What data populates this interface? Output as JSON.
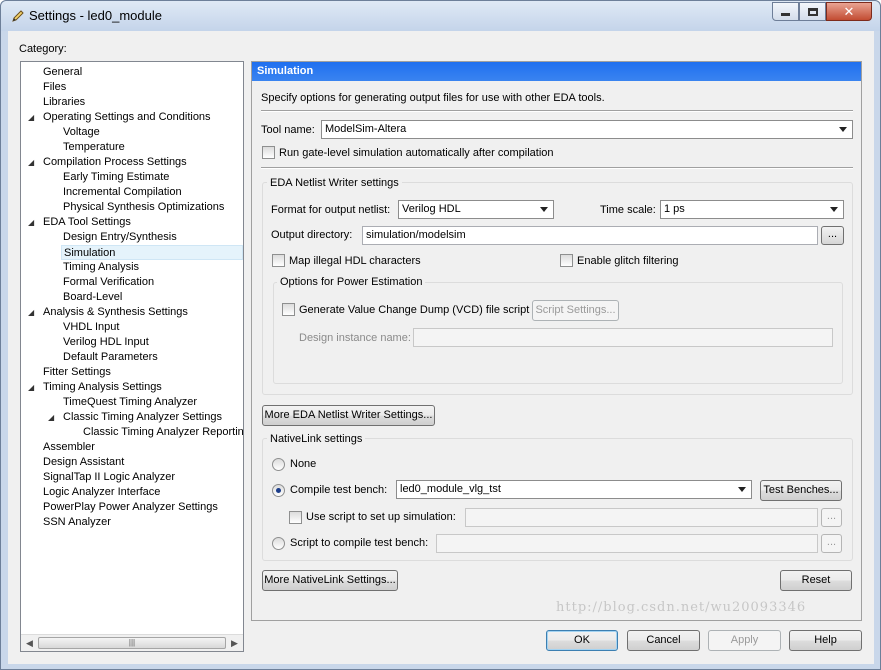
{
  "window": {
    "title": "Settings - led0_module"
  },
  "category_label": "Category:",
  "tree": [
    {
      "label": "General",
      "level": 0,
      "expander": ""
    },
    {
      "label": "Files",
      "level": 0,
      "expander": ""
    },
    {
      "label": "Libraries",
      "level": 0,
      "expander": ""
    },
    {
      "label": "Operating Settings and Conditions",
      "level": 0,
      "expander": "◢"
    },
    {
      "label": "Voltage",
      "level": 1,
      "expander": ""
    },
    {
      "label": "Temperature",
      "level": 1,
      "expander": ""
    },
    {
      "label": "Compilation Process Settings",
      "level": 0,
      "expander": "◢"
    },
    {
      "label": "Early Timing Estimate",
      "level": 1,
      "expander": ""
    },
    {
      "label": "Incremental Compilation",
      "level": 1,
      "expander": ""
    },
    {
      "label": "Physical Synthesis Optimizations",
      "level": 1,
      "expander": ""
    },
    {
      "label": "EDA Tool Settings",
      "level": 0,
      "expander": "◢"
    },
    {
      "label": "Design Entry/Synthesis",
      "level": 1,
      "expander": ""
    },
    {
      "label": "Simulation",
      "level": 1,
      "expander": "",
      "selected": true
    },
    {
      "label": "Timing Analysis",
      "level": 1,
      "expander": ""
    },
    {
      "label": "Formal Verification",
      "level": 1,
      "expander": ""
    },
    {
      "label": "Board-Level",
      "level": 1,
      "expander": ""
    },
    {
      "label": "Analysis & Synthesis Settings",
      "level": 0,
      "expander": "◢"
    },
    {
      "label": "VHDL Input",
      "level": 1,
      "expander": ""
    },
    {
      "label": "Verilog HDL Input",
      "level": 1,
      "expander": ""
    },
    {
      "label": "Default Parameters",
      "level": 1,
      "expander": ""
    },
    {
      "label": "Fitter Settings",
      "level": 0,
      "expander": ""
    },
    {
      "label": "Timing Analysis Settings",
      "level": 0,
      "expander": "◢"
    },
    {
      "label": "TimeQuest Timing Analyzer",
      "level": 1,
      "expander": ""
    },
    {
      "label": "Classic Timing Analyzer Settings",
      "level": 1,
      "expander": "◢"
    },
    {
      "label": "Classic Timing Analyzer Reporting",
      "level": 2,
      "expander": ""
    },
    {
      "label": "Assembler",
      "level": 0,
      "expander": ""
    },
    {
      "label": "Design Assistant",
      "level": 0,
      "expander": ""
    },
    {
      "label": "SignalTap II Logic Analyzer",
      "level": 0,
      "expander": ""
    },
    {
      "label": "Logic Analyzer Interface",
      "level": 0,
      "expander": ""
    },
    {
      "label": "PowerPlay Power Analyzer Settings",
      "level": 0,
      "expander": ""
    },
    {
      "label": "SSN Analyzer",
      "level": 0,
      "expander": ""
    }
  ],
  "panel": {
    "header": "Simulation",
    "description": "Specify options for generating output files for use with other EDA tools.",
    "tool_name_label": "Tool name:",
    "tool_name_value": "ModelSim-Altera",
    "gate_level_label": "Run gate-level simulation automatically after compilation",
    "netlist_group": {
      "title": "EDA Netlist Writer settings",
      "format_label": "Format for output netlist:",
      "format_value": "Verilog HDL",
      "timescale_label": "Time scale:",
      "timescale_value": "1 ps",
      "output_dir_label": "Output directory:",
      "output_dir_value": "simulation/modelsim",
      "browse": "...",
      "map_illegal_label": "Map illegal HDL characters",
      "glitch_label": "Enable glitch filtering",
      "power_group": {
        "title": "Options for Power Estimation",
        "vcd_label": "Generate Value Change Dump (VCD) file script",
        "script_settings": "Script Settings...",
        "instance_label": "Design instance name:"
      }
    },
    "more_netlist_button": "More EDA Netlist Writer Settings...",
    "nativelink_group": {
      "title": "NativeLink settings",
      "none_label": "None",
      "compile_label": "Compile test bench:",
      "compile_value": "led0_module_vlg_tst",
      "test_benches_button": "Test Benches...",
      "use_script_label": "Use script to set up simulation:",
      "script_compile_label": "Script to compile test bench:",
      "browse": "..."
    },
    "more_nativelink_button": "More NativeLink Settings...",
    "reset_button": "Reset"
  },
  "footer": {
    "ok": "OK",
    "cancel": "Cancel",
    "apply": "Apply",
    "help": "Help"
  },
  "watermark": "http://blog.csdn.net/wu20093346"
}
